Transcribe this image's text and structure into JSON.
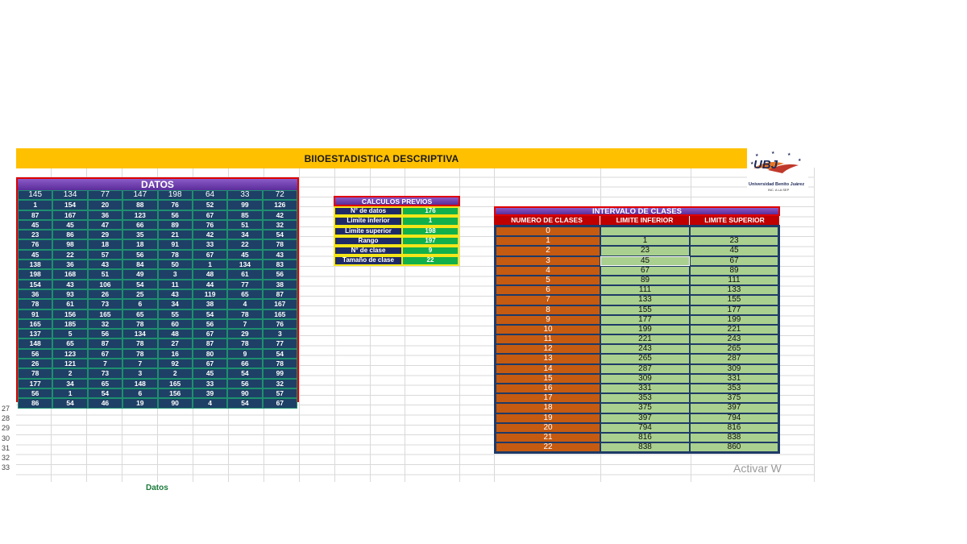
{
  "title": "BIIOESTADISTICA DESCRIPTIVA",
  "logo": {
    "mark": "UBJ",
    "name": "Universidad Benito Juárez",
    "tagline": "INC. A LA SEP"
  },
  "datos": {
    "header": "DATOS",
    "rows": [
      [
        "145",
        "134",
        "77",
        "147",
        "198",
        "64",
        "33",
        "72"
      ],
      [
        "1",
        "154",
        "20",
        "88",
        "76",
        "52",
        "99",
        "126"
      ],
      [
        "87",
        "167",
        "36",
        "123",
        "56",
        "67",
        "85",
        "42"
      ],
      [
        "45",
        "45",
        "47",
        "66",
        "89",
        "76",
        "51",
        "32"
      ],
      [
        "23",
        "86",
        "29",
        "35",
        "21",
        "42",
        "34",
        "54"
      ],
      [
        "76",
        "98",
        "18",
        "18",
        "91",
        "33",
        "22",
        "78"
      ],
      [
        "45",
        "22",
        "57",
        "56",
        "78",
        "67",
        "45",
        "43"
      ],
      [
        "138",
        "36",
        "43",
        "84",
        "50",
        "1",
        "134",
        "83"
      ],
      [
        "198",
        "168",
        "51",
        "49",
        "3",
        "48",
        "61",
        "56"
      ],
      [
        "154",
        "43",
        "106",
        "54",
        "11",
        "44",
        "77",
        "38"
      ],
      [
        "36",
        "93",
        "26",
        "25",
        "43",
        "119",
        "65",
        "87"
      ],
      [
        "78",
        "61",
        "73",
        "6",
        "34",
        "38",
        "4",
        "167"
      ],
      [
        "91",
        "156",
        "165",
        "65",
        "55",
        "54",
        "78",
        "165"
      ],
      [
        "165",
        "185",
        "32",
        "78",
        "60",
        "56",
        "7",
        "76"
      ],
      [
        "137",
        "5",
        "56",
        "134",
        "48",
        "67",
        "29",
        "3"
      ],
      [
        "148",
        "65",
        "87",
        "78",
        "27",
        "87",
        "78",
        "77"
      ],
      [
        "56",
        "123",
        "67",
        "78",
        "16",
        "80",
        "9",
        "54"
      ],
      [
        "26",
        "121",
        "7",
        "7",
        "92",
        "67",
        "66",
        "78"
      ],
      [
        "78",
        "2",
        "73",
        "3",
        "2",
        "45",
        "54",
        "99"
      ],
      [
        "177",
        "34",
        "65",
        "148",
        "165",
        "33",
        "56",
        "32"
      ],
      [
        "56",
        "1",
        "54",
        "6",
        "156",
        "39",
        "90",
        "57"
      ],
      [
        "86",
        "54",
        "46",
        "19",
        "90",
        "4",
        "54",
        "67"
      ]
    ]
  },
  "calculos": {
    "header": "CALCULOS PREVIOS",
    "rows": [
      {
        "label": "N° de datos",
        "value": "176"
      },
      {
        "label": "Limite inferior",
        "value": "1"
      },
      {
        "label": "Limite superior",
        "value": "198"
      },
      {
        "label": "Rango",
        "value": "197"
      },
      {
        "label": "N° de clase",
        "value": "9"
      },
      {
        "label": "Tamaño de clase",
        "value": "22"
      }
    ]
  },
  "intervalo": {
    "header": "INTERVALO DE CLASES",
    "columns": [
      "NUMERO DE CLASES",
      "LIMITE INFERIOR",
      "LIMITE SUPERIOR"
    ],
    "rows": [
      [
        "0",
        "",
        ""
      ],
      [
        "1",
        "1",
        "23"
      ],
      [
        "2",
        "23",
        "45"
      ],
      [
        "3",
        "45",
        "67"
      ],
      [
        "4",
        "67",
        "89"
      ],
      [
        "5",
        "89",
        "111"
      ],
      [
        "6",
        "111",
        "133"
      ],
      [
        "7",
        "133",
        "155"
      ],
      [
        "8",
        "155",
        "177"
      ],
      [
        "9",
        "177",
        "199"
      ],
      [
        "10",
        "199",
        "221"
      ],
      [
        "11",
        "221",
        "243"
      ],
      [
        "12",
        "243",
        "265"
      ],
      [
        "13",
        "265",
        "287"
      ],
      [
        "14",
        "287",
        "309"
      ],
      [
        "15",
        "309",
        "331"
      ],
      [
        "16",
        "331",
        "353"
      ],
      [
        "17",
        "353",
        "375"
      ],
      [
        "18",
        "375",
        "397"
      ],
      [
        "19",
        "397",
        "794"
      ],
      [
        "20",
        "794",
        "816"
      ],
      [
        "21",
        "816",
        "838"
      ],
      [
        "22",
        "838",
        "860"
      ]
    ]
  },
  "row_numbers": [
    "27",
    "28",
    "29",
    "30",
    "31",
    "32",
    "33"
  ],
  "watermark": "Activar W",
  "sheet_tab": "Datos"
}
